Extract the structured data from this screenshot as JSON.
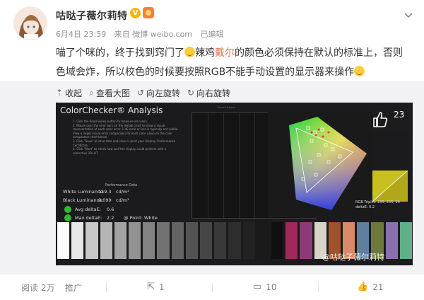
{
  "post": {
    "username": "咕哒子薇尔莉特",
    "badge_v": "V",
    "date": "6月4日 23:59",
    "source": "来自 微博 weibo.com",
    "edited": "已编辑",
    "text_line1_a": "喵了个咪的，终于找到窍门了",
    "text_line1_b": "辣鸡",
    "text_line1_highlight": "戴尔",
    "text_line1_c": "的颜色必须保持在默认的标准上，否则",
    "text_line2": "色域会炸，所以校色的时候要按照RGB不能手动设置的显示器来操作"
  },
  "toolbar": {
    "collapse": "收起",
    "view_large": "查看大图",
    "rotate_left": "向左旋转",
    "rotate_right": "向右旋转"
  },
  "image": {
    "title": "ColorChecker® Analysis",
    "instructions": [
      "1. Click the Read Series button to measure all colors.",
      "2. Mouse over the error bars on the deltaE chart to show a visual representation of each color error. 1 dE error or less is typically not visible.",
      "View a larger visual error comparison for each color value on the color comparator chart below.",
      "3. Click \"Save\" to save data and view or print your Display Conformance Certificate.",
      "4. Click \"Next\" to check how well the display could perform with a corrective 3D LUT."
    ],
    "perf_heading": "Performance Data",
    "white_lum_label": "White Luminance:",
    "white_lum_value": "119.3",
    "white_lum_unit": "cd/m²",
    "black_lum_label": "Black Luminance:",
    "black_lum_value": "0.099",
    "black_lum_unit": "cd/m²",
    "avg_label": "Avg deltaE:",
    "avg_value": "0.6",
    "max_label": "Max deltaE:",
    "max_value": "2.2",
    "point_label": "@ Point: White",
    "chart_label": "Overall Gamut",
    "rgb_triplet": "RGB Triplet: 235, 235, 16",
    "rgb_delta": "deltaE: 0.2",
    "like_count": "23",
    "watermark": "@咕哒子薇尔莉特"
  },
  "swatch_colors": [
    "#fbfbfb",
    "#e8e8e8",
    "#c8c8c8",
    "#b5b5b5",
    "#a3a3a3",
    "#929292",
    "#828282",
    "#727272",
    "#636363",
    "#535353",
    "#464646",
    "#393939",
    "#2d2d2d",
    "#222222",
    "#1a1a1a",
    "#101010",
    "#a0285a",
    "#8c3a78",
    "#d7d4c8",
    "#a0522d",
    "#d88a6a",
    "#5f7f9f",
    "#6b7a3a",
    "#8a6fae",
    "#5fb08a"
  ],
  "actions": {
    "reads": "阅读 2万",
    "promote": "推广",
    "shares": "1",
    "comments": "10",
    "likes": "21"
  }
}
